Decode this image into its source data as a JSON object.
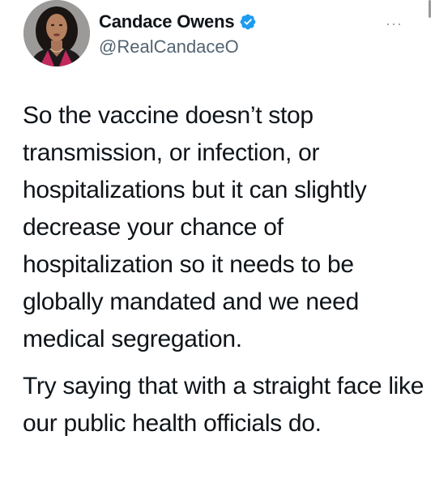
{
  "tweet": {
    "author": {
      "display_name": "Candace Owens",
      "handle": "@RealCandaceO",
      "verified": true,
      "avatar_icon": "profile-photo"
    },
    "more_label": "···",
    "paragraphs": [
      "So the vaccine doesn’t stop transmission, or infection, or hospitalizations but it can slightly decrease your chance of hospitalization so it needs to be globally mandated and we need medical segregation.",
      "Try saying that with a straight face like our public health officials do."
    ]
  },
  "colors": {
    "verified_badge": "#1d9bf0",
    "secondary_text": "#536471",
    "primary_text": "#0f1419"
  }
}
